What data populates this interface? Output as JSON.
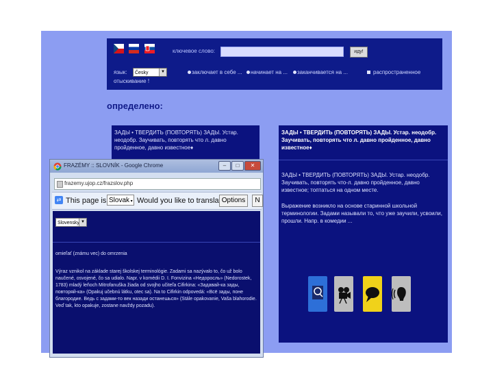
{
  "topbar": {
    "search_label": "ключевое слово:",
    "search_value": "",
    "search_button": "иду!",
    "language_label": "язык:",
    "language_select": "Česky",
    "options": [
      "заключает в себе ...",
      "начинает на ...",
      "заканчивается на ...",
      "распространенное"
    ],
    "option_line2": "отыскивание !"
  },
  "heading": "определено:",
  "left_panel": {
    "text": "ЗАДЫ • ТВЕРДИТЬ (ПОВТОРЯТЬ) ЗАДЫ. Устар. неодобр. Заучивать, повторять что л. давно пройденное, давно известное♦"
  },
  "right_panel": {
    "title": "ЗАДЫ • ТВЕРДИТЬ (ПОВТОРЯТЬ) ЗАДЫ. Устар. неодобр. Заучивать, повторять что л. давно пройденное, давно известное♦",
    "para1": "ЗАДЫ • ТВЕРДИТЬ (ПОВТОРЯТЬ) ЗАДЫ. Устар. неодобр. Заучивать, повторять что-л. давно пройденное, давно известное; топтаться на одном месте.",
    "para2": "Выражение возникло на основе старинной школьной терминологии. Задами называли то, что уже заучили, усвоили, прошли. Напр. в комедии ..."
  },
  "icons": [
    "dictionary-icon",
    "film-icon",
    "speech-icon",
    "audio-icon"
  ],
  "colors": {
    "site_bg": "#8c9df2",
    "panel_bg": "#0b127f",
    "icon_blue": "#2d6fd8",
    "icon_gray": "#bdbdbd",
    "icon_yellow": "#f0d21a"
  },
  "chrome": {
    "title": "FRAZÉMY :: SLOVNÍK - Google Chrome",
    "url": "frazemy.ujop.cz/frazslov.php",
    "translate_prefix": "This page is in",
    "translate_lang": "Slovak",
    "translate_question": "Would you like to translate it?",
    "translate_button": "Options",
    "translate_button2": "N",
    "content_select": "Slovensky",
    "content_line1": "omieľať (známu vec) do omrzenia",
    "content_para": "Výraz vznikol na základe starej školskej terminológie. Zadami sa nazývalo to, čo už bolo naučené, osvojené, čo sa udialo. Napr. v komédii D. I. Fonvizina «Недоросль» (Nedorostek, 1783) mladý leňoch Mitrofanuška žiada od svojho učiteľa Cifirkina: «Задавай-ка зады, повторяй-ка» (Opakuj učebnú látku, otec sa). Na to Cifirkin odpovedá: «Всё зады, поне благородие. Ведь с задами-то век назади останешься» (Stále opakovanie, Vaša blahorodie. Veď tak, kto opakuje, zostane navždy pozadu)."
  }
}
